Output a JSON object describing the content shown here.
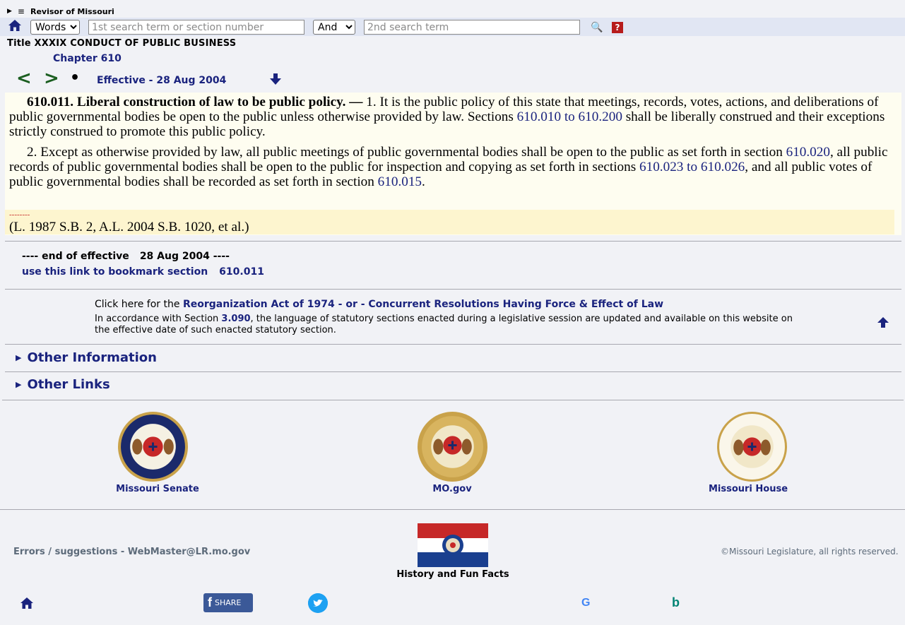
{
  "header": {
    "site_title": "Revisor of Missouri",
    "search": {
      "mode_selected": "Words",
      "term1_placeholder": "1st search term or section number",
      "operator_selected": "And",
      "term2_placeholder": "2nd search term",
      "help_label": "?"
    }
  },
  "breadcrumb": {
    "title": "Title XXXIX CONDUCT OF PUBLIC BUSINESS",
    "chapter": "Chapter 610",
    "prev_label": "<",
    "next_label": ">",
    "dot_label": "•",
    "effective": "Effective - 28 Aug 2004"
  },
  "statute": {
    "section_heading": "610.011.  Liberal construction of law to be public policy. —",
    "p1_a": " 1.  It is the public policy of this state that meetings, records, votes, actions, and deliberations of public governmental bodies be open to the public unless otherwise provided by law.  Sections ",
    "p1_link": "610.010 to 610.200",
    "p1_b": " shall be liberally construed and their exceptions strictly construed to promote this public policy.",
    "p2_a": "2.  Except as otherwise provided by law, all public meetings of public governmental bodies shall be open to the public as set forth in section ",
    "p2_link1": "610.020",
    "p2_b": ", all public records of public governmental bodies shall be open to the public for inspection and copying as set forth in sections ",
    "p2_link2": "610.023 to 610.026",
    "p2_c": ", and all public votes of public governmental bodies shall be recorded as set forth in section ",
    "p2_link3": "610.015",
    "p2_d": ".",
    "history_dashes": "--------",
    "history": "(L. 1987 S.B. 2, A.L. 2004 S.B. 1020, et al.)"
  },
  "end_block": {
    "end_label": "---- end of effective",
    "end_date": "28 Aug 2004 ----",
    "bookmark_label": "use this link to bookmark section",
    "bookmark_section": "610.011"
  },
  "info": {
    "reorg_prefix": "Click here for the ",
    "reorg_link": "Reorganization Act of 1974 - or - Concurrent Resolutions Having Force & Effect of Law",
    "accord_a": "In accordance with Section ",
    "accord_link": "3.090",
    "accord_b": ", the language of statutory sections enacted during a legislative session are updated and available on this website on the effective date of such enacted statutory section."
  },
  "sections": {
    "other_information": "Other Information",
    "other_links": "Other Links"
  },
  "seals": [
    {
      "label": "Missouri Senate"
    },
    {
      "label": "MO.gov"
    },
    {
      "label": "Missouri House"
    }
  ],
  "footer": {
    "errors": "Errors / suggestions - WebMaster@LR.mo.gov",
    "fun_facts": "History and Fun Facts",
    "copyright": "©Missouri Legislature, all rights reserved.",
    "share_label": "SHARE",
    "google_label": "G",
    "bing_label": "b"
  },
  "colors": {
    "link": "#1a237e",
    "statute_bg": "#fefdf0",
    "history_bg": "#fdf5cf",
    "nav_arrow": "#1b5e20"
  }
}
